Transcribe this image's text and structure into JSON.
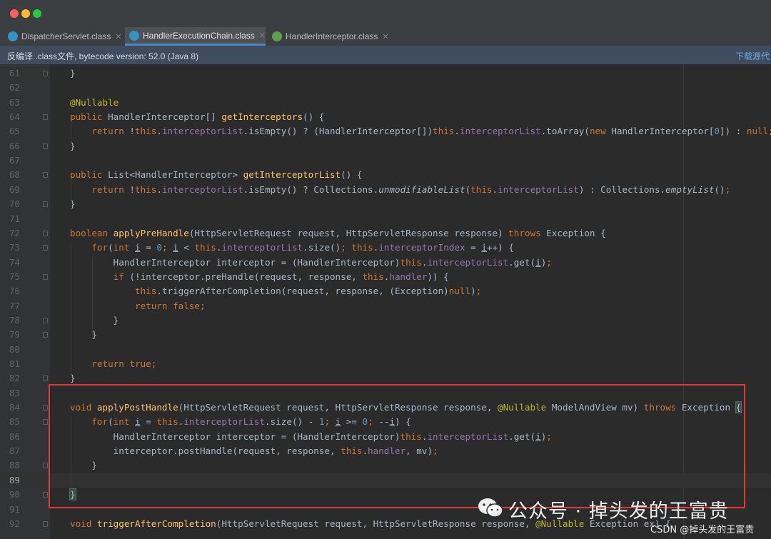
{
  "colors": {
    "keyword": "#cc7832",
    "field": "#9876aa",
    "method": "#ffc66d",
    "annotation": "#bbb529",
    "number": "#6897bb",
    "plain": "#a9b7c6",
    "highlight_box": "#e23a3a"
  },
  "tabs": [
    {
      "label": "DispatcherServlet.class",
      "icon": "class-icon",
      "active": false
    },
    {
      "label": "HandlerExecutionChain.class",
      "icon": "class-icon",
      "active": true
    },
    {
      "label": "HandlerInterceptor.class",
      "icon": "interface-icon",
      "active": false
    }
  ],
  "infobar": {
    "text": "反编译 .class文件, bytecode version: 52.0 (Java 8)",
    "link": "下载源代"
  },
  "lines": [
    {
      "n": "61",
      "cur": false,
      "tokens": [
        [
          "p",
          "    }"
        ]
      ]
    },
    {
      "n": "62",
      "cur": false,
      "tokens": []
    },
    {
      "n": "63",
      "cur": false,
      "tokens": [
        [
          "a",
          "    @Nullable"
        ]
      ]
    },
    {
      "n": "64",
      "cur": false,
      "tokens": [
        [
          "k",
          "    public "
        ],
        [
          "p",
          "HandlerInterceptor[] "
        ],
        [
          "m",
          "getInterceptors"
        ],
        [
          "p",
          "() {"
        ]
      ]
    },
    {
      "n": "65",
      "cur": false,
      "tokens": [
        [
          "k",
          "        return "
        ],
        [
          "p",
          "!"
        ],
        [
          "k",
          "this"
        ],
        [
          "p",
          "."
        ],
        [
          "f",
          "interceptorList"
        ],
        [
          "p",
          ".isEmpty() ? (HandlerInterceptor[])"
        ],
        [
          "k",
          "this"
        ],
        [
          "p",
          "."
        ],
        [
          "f",
          "interceptorList"
        ],
        [
          "p",
          ".toArray("
        ],
        [
          "k",
          "new "
        ],
        [
          "p",
          "HandlerInterceptor["
        ],
        [
          "n",
          "0"
        ],
        [
          "p",
          "]) : "
        ],
        [
          "k",
          "null"
        ],
        [
          "k",
          ";"
        ]
      ]
    },
    {
      "n": "66",
      "cur": false,
      "tokens": [
        [
          "p",
          "    }"
        ]
      ]
    },
    {
      "n": "67",
      "cur": false,
      "tokens": []
    },
    {
      "n": "68",
      "cur": false,
      "tokens": [
        [
          "k",
          "    public "
        ],
        [
          "p",
          "List<HandlerInterceptor> "
        ],
        [
          "m",
          "getInterceptorList"
        ],
        [
          "p",
          "() {"
        ]
      ]
    },
    {
      "n": "69",
      "cur": false,
      "tokens": [
        [
          "k",
          "        return "
        ],
        [
          "p",
          "!"
        ],
        [
          "k",
          "this"
        ],
        [
          "p",
          "."
        ],
        [
          "f",
          "interceptorList"
        ],
        [
          "p",
          ".isEmpty() ? Collections."
        ],
        [
          "i",
          "unmodifiableList"
        ],
        [
          "p",
          "("
        ],
        [
          "k",
          "this"
        ],
        [
          "p",
          "."
        ],
        [
          "f",
          "interceptorList"
        ],
        [
          "p",
          ") : Collections."
        ],
        [
          "i",
          "emptyList"
        ],
        [
          "p",
          "()"
        ],
        [
          "k",
          ";"
        ]
      ]
    },
    {
      "n": "70",
      "cur": false,
      "tokens": [
        [
          "p",
          "    }"
        ]
      ]
    },
    {
      "n": "71",
      "cur": false,
      "tokens": []
    },
    {
      "n": "72",
      "cur": false,
      "tokens": [
        [
          "k",
          "    boolean "
        ],
        [
          "m",
          "applyPreHandle"
        ],
        [
          "p",
          "(HttpServletRequest request, HttpServletResponse response) "
        ],
        [
          "k",
          "throws "
        ],
        [
          "p",
          "Exception {"
        ]
      ]
    },
    {
      "n": "73",
      "cur": false,
      "tokens": [
        [
          "k",
          "        for"
        ],
        [
          "p",
          "("
        ],
        [
          "k",
          "int "
        ],
        [
          "u",
          "i"
        ],
        [
          "p",
          " = "
        ],
        [
          "n",
          "0"
        ],
        [
          "k",
          "; "
        ],
        [
          "u",
          "i"
        ],
        [
          "p",
          " < "
        ],
        [
          "k",
          "this"
        ],
        [
          "p",
          "."
        ],
        [
          "f",
          "interceptorList"
        ],
        [
          "p",
          ".size()"
        ],
        [
          "k",
          "; this"
        ],
        [
          "p",
          "."
        ],
        [
          "f",
          "interceptorIndex"
        ],
        [
          "p",
          " = "
        ],
        [
          "u",
          "i"
        ],
        [
          "p",
          "++) {"
        ]
      ]
    },
    {
      "n": "74",
      "cur": false,
      "tokens": [
        [
          "p",
          "            HandlerInterceptor interceptor = (HandlerInterceptor)"
        ],
        [
          "k",
          "this"
        ],
        [
          "p",
          "."
        ],
        [
          "f",
          "interceptorList"
        ],
        [
          "p",
          ".get("
        ],
        [
          "u",
          "i"
        ],
        [
          "p",
          ")"
        ],
        [
          "k",
          ";"
        ]
      ]
    },
    {
      "n": "75",
      "cur": false,
      "tokens": [
        [
          "k",
          "            if "
        ],
        [
          "p",
          "(!interceptor.preHandle(request, response, "
        ],
        [
          "k",
          "this"
        ],
        [
          "p",
          "."
        ],
        [
          "f",
          "handler"
        ],
        [
          "p",
          ")) {"
        ]
      ]
    },
    {
      "n": "76",
      "cur": false,
      "tokens": [
        [
          "k",
          "                this"
        ],
        [
          "p",
          ".triggerAfterCompletion(request, response, (Exception)"
        ],
        [
          "k",
          "null"
        ],
        [
          "p",
          ")"
        ],
        [
          "k",
          ";"
        ]
      ]
    },
    {
      "n": "77",
      "cur": false,
      "tokens": [
        [
          "k",
          "                return false;"
        ]
      ]
    },
    {
      "n": "78",
      "cur": false,
      "tokens": [
        [
          "p",
          "            }"
        ]
      ]
    },
    {
      "n": "79",
      "cur": false,
      "tokens": [
        [
          "p",
          "        }"
        ]
      ]
    },
    {
      "n": "80",
      "cur": false,
      "tokens": []
    },
    {
      "n": "81",
      "cur": false,
      "tokens": [
        [
          "k",
          "        return true;"
        ]
      ]
    },
    {
      "n": "82",
      "cur": false,
      "tokens": [
        [
          "p",
          "    }"
        ]
      ]
    },
    {
      "n": "83",
      "cur": false,
      "tokens": []
    },
    {
      "n": "84",
      "cur": false,
      "tokens": [
        [
          "k",
          "    void "
        ],
        [
          "m",
          "applyPostHandle"
        ],
        [
          "p",
          "(HttpServletRequest request, HttpServletResponse response, "
        ],
        [
          "a",
          "@Nullable "
        ],
        [
          "p",
          "ModelAndView mv) "
        ],
        [
          "k",
          "throws "
        ],
        [
          "p",
          "Exception "
        ],
        [
          "b",
          "{"
        ]
      ]
    },
    {
      "n": "85",
      "cur": false,
      "tokens": [
        [
          "k",
          "        for"
        ],
        [
          "p",
          "("
        ],
        [
          "k",
          "int "
        ],
        [
          "u",
          "i"
        ],
        [
          "p",
          " = "
        ],
        [
          "k",
          "this"
        ],
        [
          "p",
          "."
        ],
        [
          "f",
          "interceptorList"
        ],
        [
          "p",
          ".size() - "
        ],
        [
          "n",
          "1"
        ],
        [
          "k",
          "; "
        ],
        [
          "u",
          "i"
        ],
        [
          "p",
          " >= "
        ],
        [
          "n",
          "0"
        ],
        [
          "k",
          "; "
        ],
        [
          "p",
          "--"
        ],
        [
          "u",
          "i"
        ],
        [
          "p",
          ") {"
        ]
      ]
    },
    {
      "n": "86",
      "cur": false,
      "tokens": [
        [
          "p",
          "            HandlerInterceptor interceptor = (HandlerInterceptor)"
        ],
        [
          "k",
          "this"
        ],
        [
          "p",
          "."
        ],
        [
          "f",
          "interceptorList"
        ],
        [
          "p",
          ".get("
        ],
        [
          "u",
          "i"
        ],
        [
          "p",
          ")"
        ],
        [
          "k",
          ";"
        ]
      ]
    },
    {
      "n": "87",
      "cur": false,
      "tokens": [
        [
          "p",
          "            interceptor.postHandle(request, response, "
        ],
        [
          "k",
          "this"
        ],
        [
          "p",
          "."
        ],
        [
          "f",
          "handler"
        ],
        [
          "p",
          ", mv)"
        ],
        [
          "k",
          ";"
        ]
      ]
    },
    {
      "n": "88",
      "cur": false,
      "tokens": [
        [
          "p",
          "        }"
        ]
      ]
    },
    {
      "n": "89",
      "cur": true,
      "tokens": []
    },
    {
      "n": "90",
      "cur": false,
      "tokens": [
        [
          "b",
          "    }"
        ]
      ]
    },
    {
      "n": "91",
      "cur": false,
      "tokens": []
    },
    {
      "n": "92",
      "cur": false,
      "tokens": [
        [
          "k",
          "    void "
        ],
        [
          "m",
          "triggerAfterCompletion"
        ],
        [
          "p",
          "(HttpServletRequest request, HttpServletResponse response, "
        ],
        [
          "a",
          "@Nullable "
        ],
        [
          "p",
          "Exception ex) {"
        ]
      ]
    }
  ],
  "watermark": {
    "main": "公众号 · 掉头发的王富贵",
    "csdn": "CSDN @掉头发的王富贵",
    "icon": "wechat-icon"
  }
}
